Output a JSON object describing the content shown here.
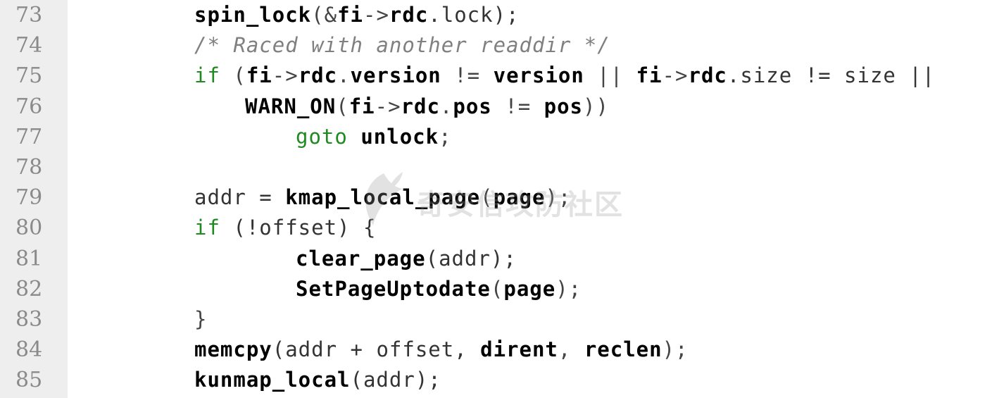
{
  "watermark": {
    "text": "奇安信攻防社区",
    "logo_icon": "qianxin-logo-icon"
  },
  "colors": {
    "gutter": "#eeeeee",
    "line_number": "#8a8a8a",
    "keyword": "#1f8a1f",
    "comment": "#808080",
    "identifier": "#000000"
  },
  "lines": [
    {
      "number": "73",
      "indent": 1,
      "tokens": [
        {
          "t": "spin_lock",
          "c": "call"
        },
        {
          "t": "(&",
          "c": "punct"
        },
        {
          "t": "fi",
          "c": "ident"
        },
        {
          "t": "->",
          "c": "punct"
        },
        {
          "t": "rdc",
          "c": "ident"
        },
        {
          "t": ".lock);",
          "c": "plain"
        }
      ]
    },
    {
      "number": "74",
      "indent": 1,
      "tokens": [
        {
          "t": "/* Raced with another readdir */",
          "c": "comment"
        }
      ]
    },
    {
      "number": "75",
      "indent": 1,
      "tokens": [
        {
          "t": "if",
          "c": "kw"
        },
        {
          "t": " (",
          "c": "punct"
        },
        {
          "t": "fi",
          "c": "ident"
        },
        {
          "t": "->",
          "c": "punct"
        },
        {
          "t": "rdc",
          "c": "ident"
        },
        {
          "t": ".",
          "c": "punct"
        },
        {
          "t": "version",
          "c": "ident"
        },
        {
          "t": " != ",
          "c": "punct"
        },
        {
          "t": "version",
          "c": "ident"
        },
        {
          "t": " || ",
          "c": "punct"
        },
        {
          "t": "fi",
          "c": "ident"
        },
        {
          "t": "->",
          "c": "punct"
        },
        {
          "t": "rdc",
          "c": "ident"
        },
        {
          "t": ".size != size ||",
          "c": "plain"
        }
      ]
    },
    {
      "number": "76",
      "indent": 2,
      "tokens": [
        {
          "t": "WARN_ON",
          "c": "call"
        },
        {
          "t": "(",
          "c": "punct"
        },
        {
          "t": "fi",
          "c": "ident"
        },
        {
          "t": "->",
          "c": "punct"
        },
        {
          "t": "rdc",
          "c": "ident"
        },
        {
          "t": ".",
          "c": "punct"
        },
        {
          "t": "pos",
          "c": "ident"
        },
        {
          "t": " != ",
          "c": "punct"
        },
        {
          "t": "pos",
          "c": "ident"
        },
        {
          "t": "))",
          "c": "punct"
        }
      ]
    },
    {
      "number": "77",
      "indent": 3,
      "tokens": [
        {
          "t": "goto",
          "c": "kw"
        },
        {
          "t": " ",
          "c": "plain"
        },
        {
          "t": "unlock",
          "c": "ident"
        },
        {
          "t": ";",
          "c": "punct"
        }
      ]
    },
    {
      "number": "78",
      "indent": 1,
      "tokens": []
    },
    {
      "number": "79",
      "indent": 1,
      "tokens": [
        {
          "t": "addr = ",
          "c": "plain"
        },
        {
          "t": "kmap_local_page",
          "c": "call"
        },
        {
          "t": "(",
          "c": "punct"
        },
        {
          "t": "page",
          "c": "ident"
        },
        {
          "t": ");",
          "c": "punct"
        }
      ]
    },
    {
      "number": "80",
      "indent": 1,
      "tokens": [
        {
          "t": "if",
          "c": "kw"
        },
        {
          "t": " (!offset) {",
          "c": "plain"
        }
      ]
    },
    {
      "number": "81",
      "indent": 3,
      "tokens": [
        {
          "t": "clear_page",
          "c": "call"
        },
        {
          "t": "(addr);",
          "c": "plain"
        }
      ]
    },
    {
      "number": "82",
      "indent": 3,
      "tokens": [
        {
          "t": "SetPageUptodate",
          "c": "call"
        },
        {
          "t": "(",
          "c": "punct"
        },
        {
          "t": "page",
          "c": "ident"
        },
        {
          "t": ");",
          "c": "punct"
        }
      ]
    },
    {
      "number": "83",
      "indent": 1,
      "tokens": [
        {
          "t": "}",
          "c": "punct"
        }
      ]
    },
    {
      "number": "84",
      "indent": 1,
      "tokens": [
        {
          "t": "memcpy",
          "c": "call"
        },
        {
          "t": "(addr + offset, ",
          "c": "plain"
        },
        {
          "t": "dirent",
          "c": "ident"
        },
        {
          "t": ", ",
          "c": "punct"
        },
        {
          "t": "reclen",
          "c": "ident"
        },
        {
          "t": ");",
          "c": "punct"
        }
      ]
    },
    {
      "number": "85",
      "indent": 1,
      "tokens": [
        {
          "t": "kunmap_local",
          "c": "call"
        },
        {
          "t": "(addr);",
          "c": "plain"
        }
      ]
    }
  ]
}
